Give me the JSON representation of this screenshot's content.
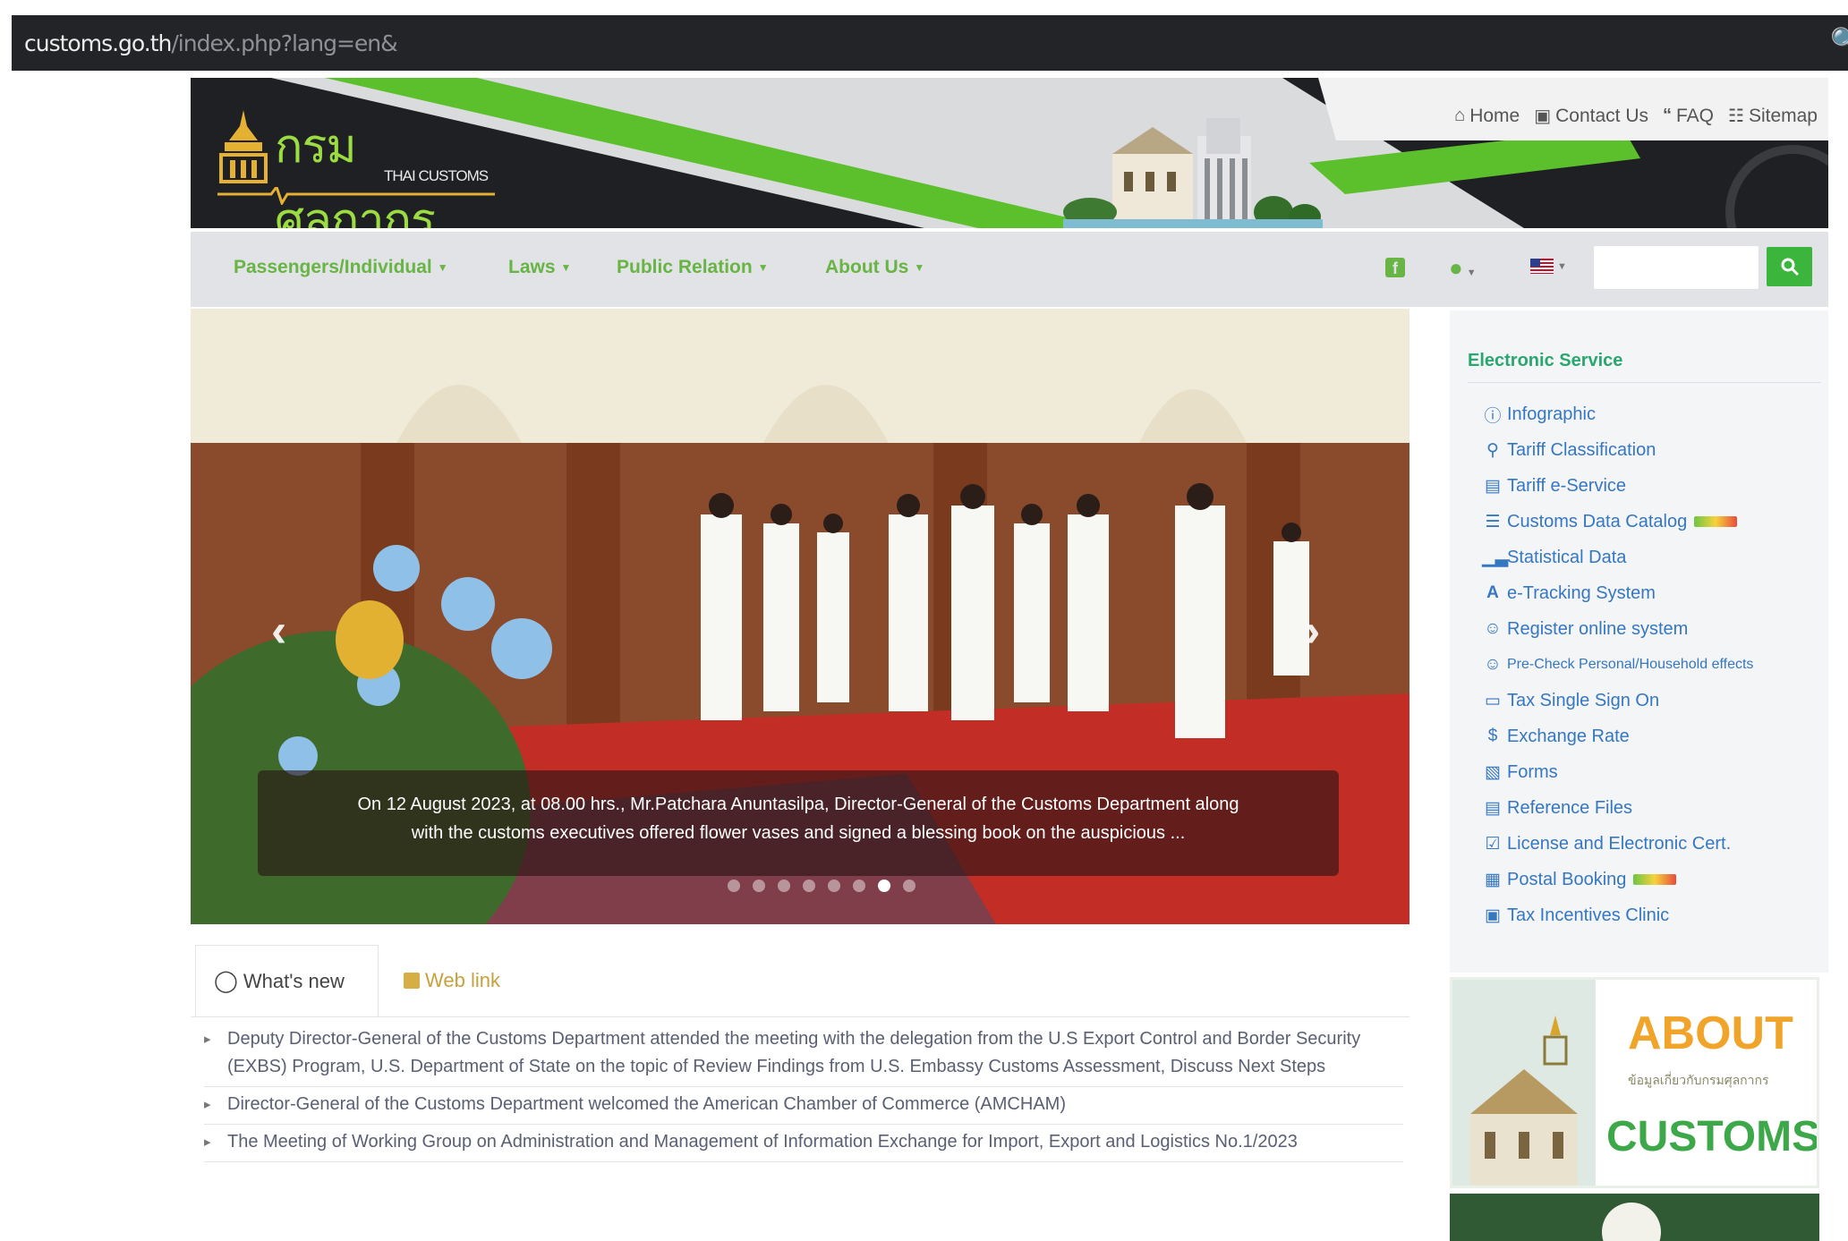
{
  "address_bar": {
    "domain": "customs.go.th",
    "path": "/index.php?lang=en&"
  },
  "header": {
    "logo_thai": "กรมศุลกากร",
    "logo_en": "THAI CUSTOMS",
    "top_links": [
      {
        "label": "Home",
        "icon": "home-icon"
      },
      {
        "label": "Contact Us",
        "icon": "contact-icon"
      },
      {
        "label": "FAQ",
        "icon": "quote-icon"
      },
      {
        "label": "Sitemap",
        "icon": "sitemap-icon"
      }
    ]
  },
  "navbar": {
    "items": [
      "Passengers/Individual",
      "Laws",
      "Public Relation",
      "About Us"
    ],
    "search_placeholder": ""
  },
  "carousel": {
    "caption_line1": "On 12 August 2023, at 08.00 hrs., Mr.Patchara Anuntasilpa, Director-General of the Customs Department along",
    "caption_line2": "with the customs executives offered flower vases and signed a blessing book on the auspicious ...",
    "slide_count": 8,
    "active_slide": 6
  },
  "eservice": {
    "title": "Electronic Service",
    "items": [
      {
        "label": "Infographic",
        "icon": "info-icon"
      },
      {
        "label": "Tariff Classification",
        "icon": "search-icon"
      },
      {
        "label": "Tariff e-Service",
        "icon": "window-icon"
      },
      {
        "label": "Customs Data Catalog",
        "icon": "database-icon",
        "new": true
      },
      {
        "label": "Statistical Data",
        "icon": "bar-chart-icon"
      },
      {
        "label": "e-Tracking System",
        "icon": "tracking-icon"
      },
      {
        "label": "Register online system",
        "icon": "user-icon"
      },
      {
        "label": "Pre-Check Personal/Household effects",
        "icon": "user-check-icon"
      },
      {
        "label": "Tax Single Sign On",
        "icon": "monitor-icon"
      },
      {
        "label": "Exchange Rate",
        "icon": "dollar-icon"
      },
      {
        "label": "Forms",
        "icon": "forms-icon"
      },
      {
        "label": "Reference Files",
        "icon": "file-icon"
      },
      {
        "label": "License and Electronic Cert.",
        "icon": "check-square-icon"
      },
      {
        "label": "Postal Booking",
        "icon": "calendar-icon",
        "new": true
      },
      {
        "label": "Tax Incentives Clinic",
        "icon": "briefcase-icon"
      }
    ]
  },
  "tabs": {
    "whats_new": "What's new",
    "web_link": "Web link"
  },
  "news": [
    "Deputy Director-General of the Customs Department attended the meeting with the delegation from the U.S Export Control and Border Security (EXBS) Program, U.S. Department of State on the topic of Review Findings from U.S. Embassy Customs Assessment, Discuss Next Steps",
    "Director-General of the Customs Department welcomed the American Chamber of Commerce (AMCHAM)",
    "The Meeting of Working Group on Administration and Management of Information Exchange for Import, Export and Logistics No.1/2023"
  ],
  "about_banner": {
    "title": "ABOUT",
    "subtitle": "ข้อมูลเกี่ยวกับกรมศุลกากร",
    "brand": "CUSTOMS"
  },
  "colors": {
    "brand_green": "#68b444",
    "link_blue": "#3577c2",
    "header_dark": "#1f2023"
  }
}
